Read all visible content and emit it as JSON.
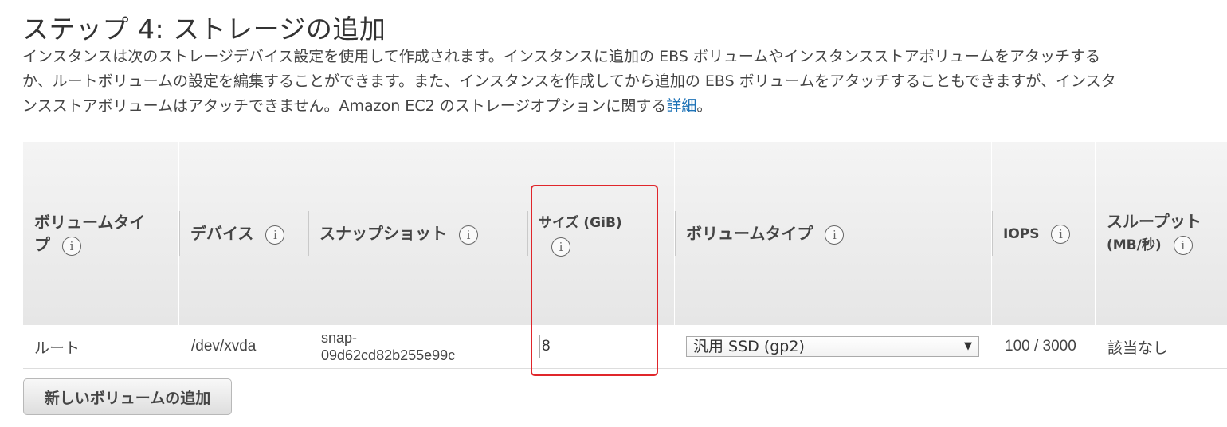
{
  "page": {
    "title": "ステップ 4: ストレージの追加",
    "description_line1": "インスタンスは次のストレージデバイス設定を使用して作成されます。インスタンスに追加の EBS ボリュームやインスタンスストアボリュームをアタッチする",
    "description_line2": "か、ルートボリュームの設定を編集することができます。また、インスタンスを作成してから追加の EBS ボリュームをアタッチすることもできますが、インスタ",
    "description_line3_prefix": "ンスストアボリュームはアタッチできません。Amazon EC2 のストレージオプションに関する",
    "description_link": "詳細",
    "description_suffix": "。"
  },
  "table": {
    "headers": [
      {
        "label": "ボリュームタイプ",
        "info_icon": "info-icon"
      },
      {
        "label": "デバイス",
        "info_icon": "info-icon"
      },
      {
        "label": "スナップショット",
        "info_icon": "info-icon"
      },
      {
        "label": "サイズ (GiB)",
        "info_icon": "info-icon"
      },
      {
        "label": "ボリュームタイプ",
        "info_icon": "info-icon"
      },
      {
        "label": "IOPS",
        "info_icon": "info-icon"
      },
      {
        "label": "スループット (MB/秒)",
        "info_icon": "info-icon"
      }
    ],
    "rows": [
      {
        "volume_type": "ルート",
        "device": "/dev/xvda",
        "snapshot": "snap-09d62cd82b255e99c",
        "snapshot_line1": "snap-",
        "snapshot_line2": "09d62cd82b255e99c",
        "size": "8",
        "ebs_type": "汎用 SSD (gp2)",
        "iops": "100 / 3000",
        "throughput": "該当なし"
      }
    ]
  },
  "buttons": {
    "add_volume": "新しいボリュームの追加"
  },
  "colors": {
    "highlight": "#e0262b",
    "link": "#1f73b7"
  }
}
